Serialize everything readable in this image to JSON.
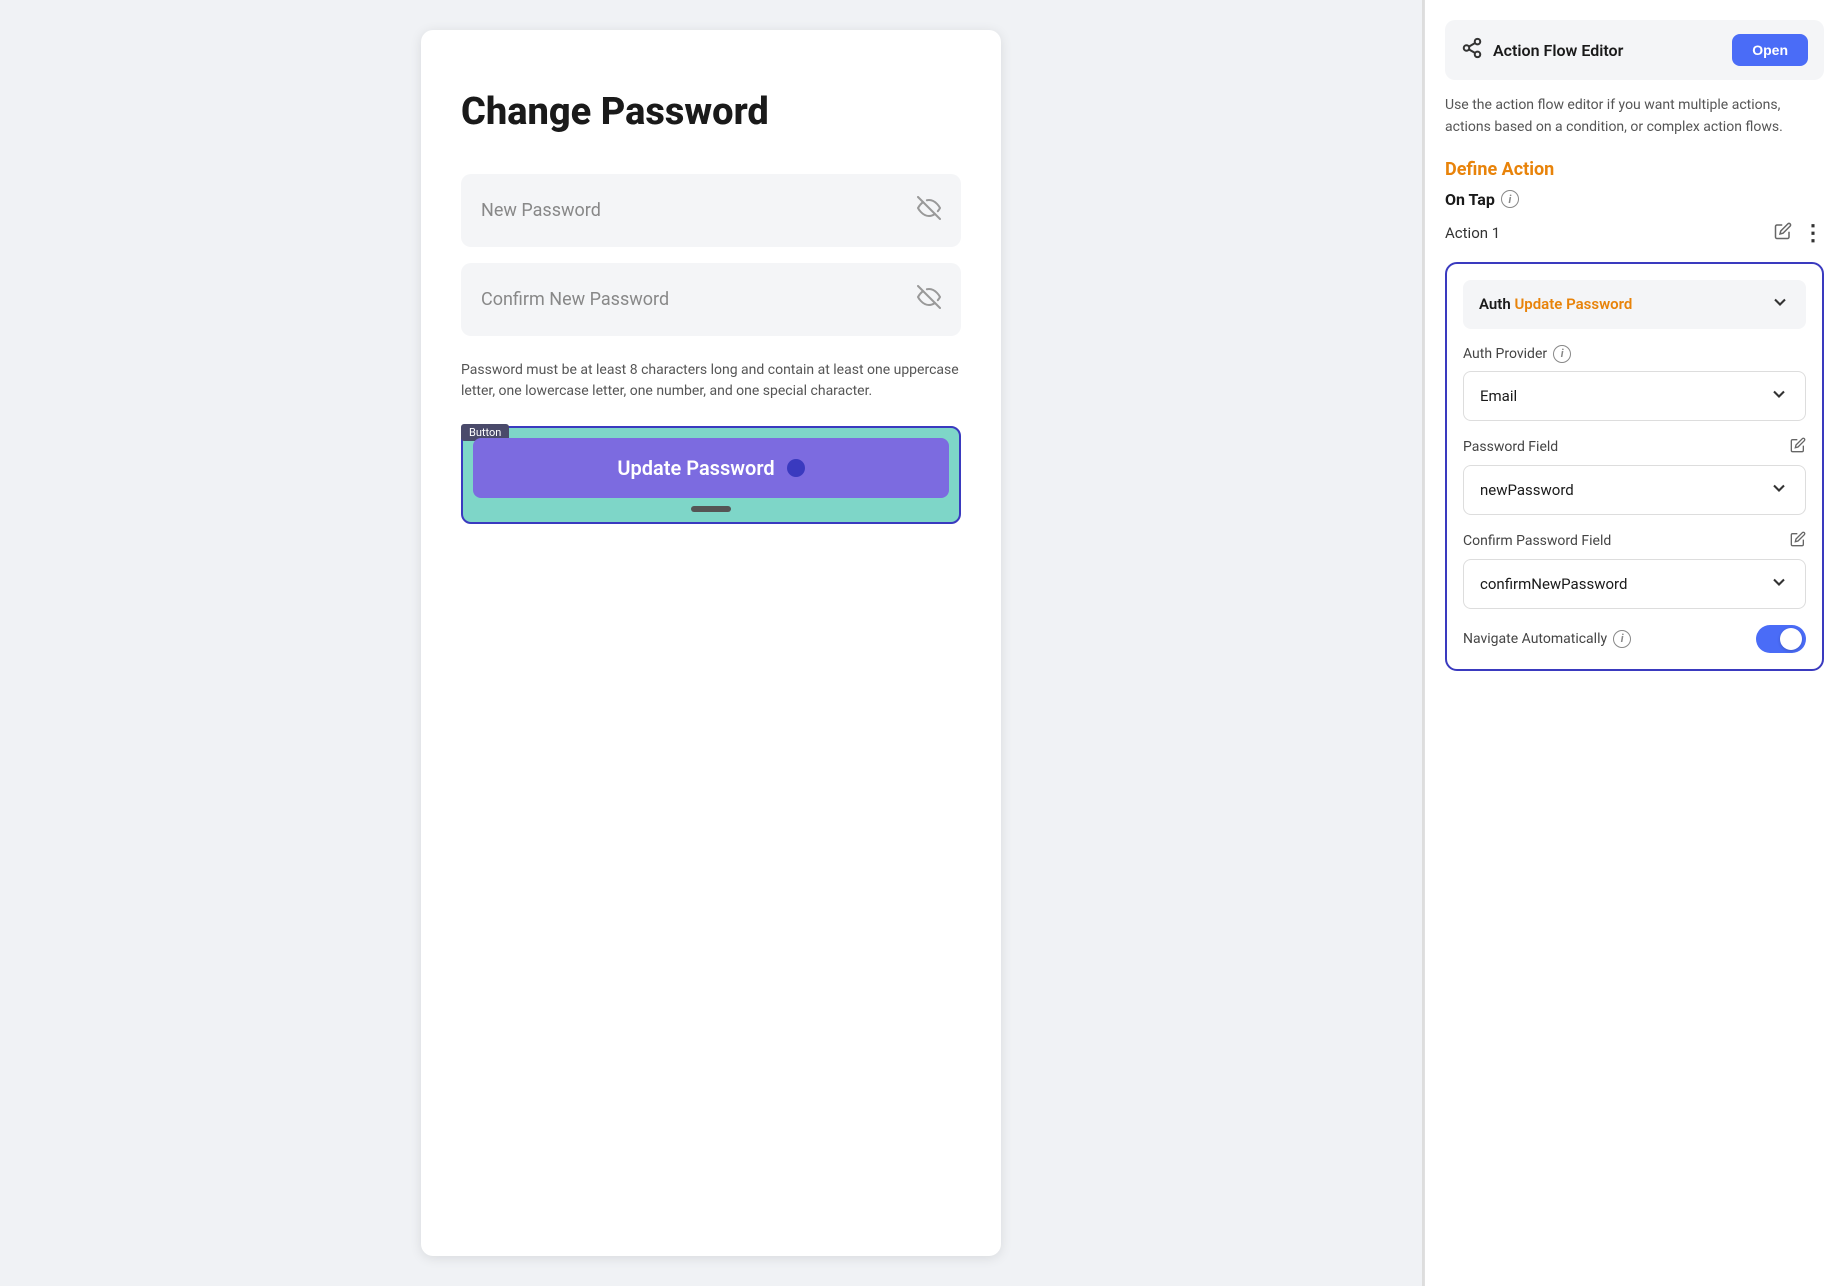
{
  "preview": {
    "page_title": "Change Password",
    "new_password_placeholder": "New Password",
    "confirm_password_placeholder": "Confirm New Password",
    "password_hint": "Password must be at least 8 characters long and contain at least one uppercase letter, one lowercase letter, one number, and one special character.",
    "button_label": "Button",
    "update_button_text": "Update Password"
  },
  "action_panel": {
    "action_flow_title": "Action Flow Editor",
    "open_button": "Open",
    "description": "Use the action flow editor if you want multiple actions, actions based on a condition, or complex action flows.",
    "define_action_title": "Define Action",
    "on_tap_label": "On Tap",
    "action1_label": "Action 1",
    "auth_selector": {
      "prefix": "Auth",
      "action": "Update Password"
    },
    "auth_provider_label": "Auth Provider",
    "auth_provider_info": "i",
    "auth_provider_value": "Email",
    "password_field_label": "Password Field",
    "password_field_value": "newPassword",
    "confirm_password_field_label": "Confirm Password Field",
    "confirm_password_field_value": "confirmNewPassword",
    "navigate_label": "Navigate Automatically",
    "info_symbol": "i"
  },
  "icons": {
    "eye_off": "🙈",
    "chevron_down": "⌄",
    "edit_pencil": "✏",
    "more_vert": "⋮",
    "flow_icon": "⇄"
  }
}
